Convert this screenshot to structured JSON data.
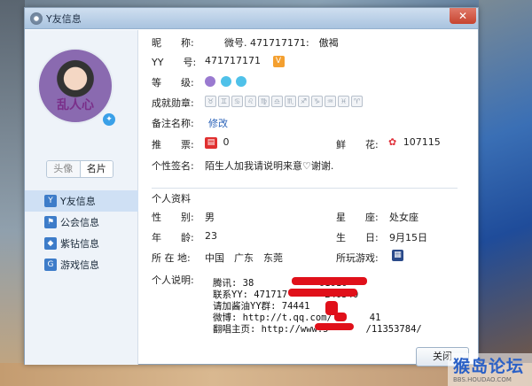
{
  "window": {
    "title": "Y友信息",
    "close_glyph": "✕",
    "close_button": "关闭"
  },
  "sidebar": {
    "avatar_text": "乱人心",
    "tab_avatar": "头像",
    "tab_card": "名片",
    "nav": [
      {
        "label": "Y友信息",
        "icon": "yy-icon",
        "color": "#3d7cc9"
      },
      {
        "label": "公会信息",
        "icon": "flag-icon",
        "color": "#3d7cc9"
      },
      {
        "label": "紫钻信息",
        "icon": "diamond-icon",
        "color": "#3d7cc9"
      },
      {
        "label": "游戏信息",
        "icon": "game-icon",
        "color": "#3d7cc9"
      }
    ]
  },
  "profile": {
    "nickname_label": "昵　　称:",
    "nickname_value": "微号. 471717171:　傲褐",
    "yy_label": "YY　　号:",
    "yy_value": "471717171",
    "vip_badge": "V",
    "level_label": "等　　级:",
    "medals_label": "成就勋章:",
    "medal_glyphs": [
      "♉",
      "♊",
      "♋",
      "♌",
      "♍",
      "♎",
      "♏",
      "♐",
      "♑",
      "♒",
      "♓",
      "♈"
    ],
    "remark_label": "备注名称:",
    "remark_link": "修改",
    "tickets_label": "推　　票:",
    "tickets_value": "0",
    "flowers_label": "鲜　　花:",
    "flowers_value": "107115",
    "signature_label": "个性签名:",
    "signature_value": "陌生人加我请说明来意♡谢谢."
  },
  "personal": {
    "section_title": "个人资料",
    "gender_label": "性　　别:",
    "gender_value": "男",
    "constellation_label": "星　　座:",
    "constellation_value": "处女座",
    "age_label": "年　　龄:",
    "age_value": "23",
    "birthday_label": "生　　日:",
    "birthday_value": "9月15日",
    "location_label": "所 在 地:",
    "location_value": "中国　广东　东莞",
    "games_label": "所玩游戏:",
    "desc_label": "个人说明:",
    "desc_lines": [
      "腾讯: 38　　　　　　　61616",
      "联系YY: 471717　　　　240340",
      "请加酱油YY群: 74441",
      "微博: http://t.qq.com/　　　　41",
      "翻唱主页: http://www.5　　　　/11353784/"
    ]
  },
  "watermark": {
    "main": "猴岛论坛",
    "sub": "BBS.HOUDAO.COM"
  }
}
